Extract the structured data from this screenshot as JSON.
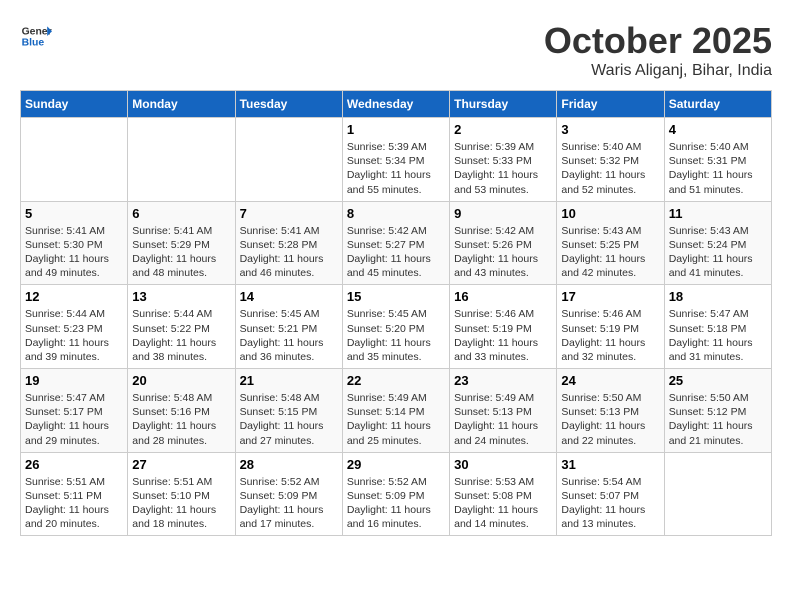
{
  "header": {
    "logo_line1": "General",
    "logo_line2": "Blue",
    "month": "October 2025",
    "location": "Waris Aliganj, Bihar, India"
  },
  "days_of_week": [
    "Sunday",
    "Monday",
    "Tuesday",
    "Wednesday",
    "Thursday",
    "Friday",
    "Saturday"
  ],
  "weeks": [
    [
      {
        "day": "",
        "content": ""
      },
      {
        "day": "",
        "content": ""
      },
      {
        "day": "",
        "content": ""
      },
      {
        "day": "1",
        "content": "Sunrise: 5:39 AM\nSunset: 5:34 PM\nDaylight: 11 hours and 55 minutes."
      },
      {
        "day": "2",
        "content": "Sunrise: 5:39 AM\nSunset: 5:33 PM\nDaylight: 11 hours and 53 minutes."
      },
      {
        "day": "3",
        "content": "Sunrise: 5:40 AM\nSunset: 5:32 PM\nDaylight: 11 hours and 52 minutes."
      },
      {
        "day": "4",
        "content": "Sunrise: 5:40 AM\nSunset: 5:31 PM\nDaylight: 11 hours and 51 minutes."
      }
    ],
    [
      {
        "day": "5",
        "content": "Sunrise: 5:41 AM\nSunset: 5:30 PM\nDaylight: 11 hours and 49 minutes."
      },
      {
        "day": "6",
        "content": "Sunrise: 5:41 AM\nSunset: 5:29 PM\nDaylight: 11 hours and 48 minutes."
      },
      {
        "day": "7",
        "content": "Sunrise: 5:41 AM\nSunset: 5:28 PM\nDaylight: 11 hours and 46 minutes."
      },
      {
        "day": "8",
        "content": "Sunrise: 5:42 AM\nSunset: 5:27 PM\nDaylight: 11 hours and 45 minutes."
      },
      {
        "day": "9",
        "content": "Sunrise: 5:42 AM\nSunset: 5:26 PM\nDaylight: 11 hours and 43 minutes."
      },
      {
        "day": "10",
        "content": "Sunrise: 5:43 AM\nSunset: 5:25 PM\nDaylight: 11 hours and 42 minutes."
      },
      {
        "day": "11",
        "content": "Sunrise: 5:43 AM\nSunset: 5:24 PM\nDaylight: 11 hours and 41 minutes."
      }
    ],
    [
      {
        "day": "12",
        "content": "Sunrise: 5:44 AM\nSunset: 5:23 PM\nDaylight: 11 hours and 39 minutes."
      },
      {
        "day": "13",
        "content": "Sunrise: 5:44 AM\nSunset: 5:22 PM\nDaylight: 11 hours and 38 minutes."
      },
      {
        "day": "14",
        "content": "Sunrise: 5:45 AM\nSunset: 5:21 PM\nDaylight: 11 hours and 36 minutes."
      },
      {
        "day": "15",
        "content": "Sunrise: 5:45 AM\nSunset: 5:20 PM\nDaylight: 11 hours and 35 minutes."
      },
      {
        "day": "16",
        "content": "Sunrise: 5:46 AM\nSunset: 5:19 PM\nDaylight: 11 hours and 33 minutes."
      },
      {
        "day": "17",
        "content": "Sunrise: 5:46 AM\nSunset: 5:19 PM\nDaylight: 11 hours and 32 minutes."
      },
      {
        "day": "18",
        "content": "Sunrise: 5:47 AM\nSunset: 5:18 PM\nDaylight: 11 hours and 31 minutes."
      }
    ],
    [
      {
        "day": "19",
        "content": "Sunrise: 5:47 AM\nSunset: 5:17 PM\nDaylight: 11 hours and 29 minutes."
      },
      {
        "day": "20",
        "content": "Sunrise: 5:48 AM\nSunset: 5:16 PM\nDaylight: 11 hours and 28 minutes."
      },
      {
        "day": "21",
        "content": "Sunrise: 5:48 AM\nSunset: 5:15 PM\nDaylight: 11 hours and 27 minutes."
      },
      {
        "day": "22",
        "content": "Sunrise: 5:49 AM\nSunset: 5:14 PM\nDaylight: 11 hours and 25 minutes."
      },
      {
        "day": "23",
        "content": "Sunrise: 5:49 AM\nSunset: 5:13 PM\nDaylight: 11 hours and 24 minutes."
      },
      {
        "day": "24",
        "content": "Sunrise: 5:50 AM\nSunset: 5:13 PM\nDaylight: 11 hours and 22 minutes."
      },
      {
        "day": "25",
        "content": "Sunrise: 5:50 AM\nSunset: 5:12 PM\nDaylight: 11 hours and 21 minutes."
      }
    ],
    [
      {
        "day": "26",
        "content": "Sunrise: 5:51 AM\nSunset: 5:11 PM\nDaylight: 11 hours and 20 minutes."
      },
      {
        "day": "27",
        "content": "Sunrise: 5:51 AM\nSunset: 5:10 PM\nDaylight: 11 hours and 18 minutes."
      },
      {
        "day": "28",
        "content": "Sunrise: 5:52 AM\nSunset: 5:09 PM\nDaylight: 11 hours and 17 minutes."
      },
      {
        "day": "29",
        "content": "Sunrise: 5:52 AM\nSunset: 5:09 PM\nDaylight: 11 hours and 16 minutes."
      },
      {
        "day": "30",
        "content": "Sunrise: 5:53 AM\nSunset: 5:08 PM\nDaylight: 11 hours and 14 minutes."
      },
      {
        "day": "31",
        "content": "Sunrise: 5:54 AM\nSunset: 5:07 PM\nDaylight: 11 hours and 13 minutes."
      },
      {
        "day": "",
        "content": ""
      }
    ]
  ]
}
